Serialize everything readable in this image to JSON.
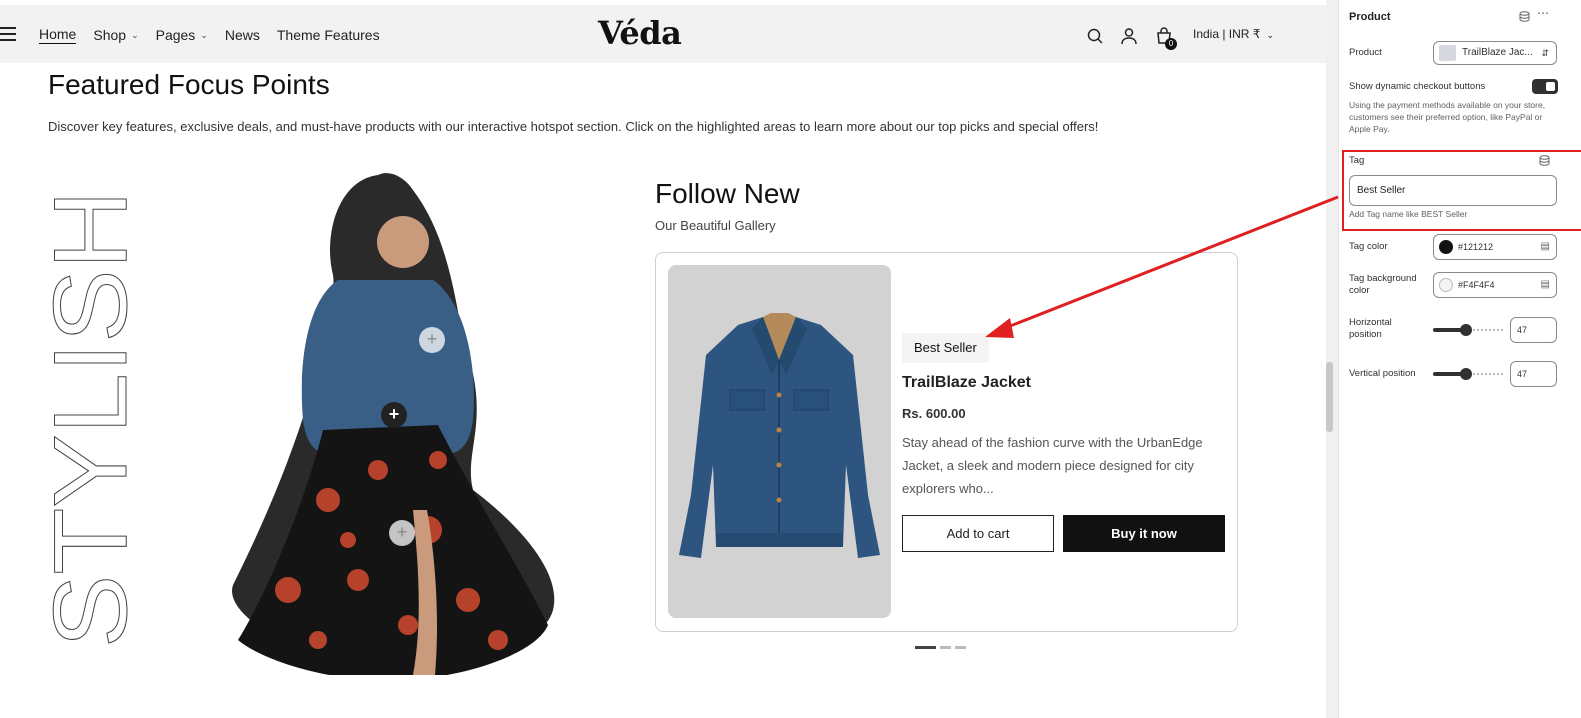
{
  "nav": {
    "items": [
      {
        "label": "Home",
        "active": true,
        "dropdown": false
      },
      {
        "label": "Shop",
        "active": false,
        "dropdown": true
      },
      {
        "label": "Pages",
        "active": false,
        "dropdown": true
      },
      {
        "label": "News",
        "active": false,
        "dropdown": false
      },
      {
        "label": "Theme Features",
        "active": false,
        "dropdown": false
      }
    ],
    "logo": "Véda",
    "cart_count": "0",
    "locale": "India | INR ₹"
  },
  "section": {
    "title": "Featured Focus Points",
    "description": "Discover key features, exclusive deals, and must-have products with our interactive hotspot section. Click on the highlighted areas to learn more about our top picks and special offers!",
    "vertical_text": "STYLISH"
  },
  "gallery": {
    "title": "Follow New",
    "subtitle": "Our Beautiful Gallery"
  },
  "product_card": {
    "tag": "Best Seller",
    "name": "TrailBlaze Jacket",
    "price": "Rs. 600.00",
    "description": "Stay ahead of the fashion curve with the UrbanEdge Jacket, a sleek and modern piece designed for city explorers who...",
    "add_to_cart": "Add to cart",
    "buy_now": "Buy it now"
  },
  "carousel": {
    "slides": 3,
    "active": 1
  },
  "panel": {
    "title": "Product",
    "product_label": "Product",
    "product_value": "TrailBlaze Jac...",
    "dynamic_checkout_label": "Show dynamic checkout buttons",
    "dynamic_checkout_on": true,
    "dynamic_checkout_help": "Using the payment methods available on your store, customers see their preferred option, like PayPal or Apple Pay.",
    "tag_label": "Tag",
    "tag_value": "Best Seller",
    "tag_help": "Add Tag name like BEST Seller",
    "tag_color_label": "Tag color",
    "tag_color_value": "#121212",
    "tag_bg_label": "Tag background color",
    "tag_bg_value": "#F4F4F4",
    "horizontal_label": "Horizontal position",
    "horizontal_value": "47",
    "vertical_label": "Vertical position",
    "vertical_value": "47"
  },
  "colors": {
    "accent_dark": "#111111",
    "annotation_red": "#e02020"
  }
}
